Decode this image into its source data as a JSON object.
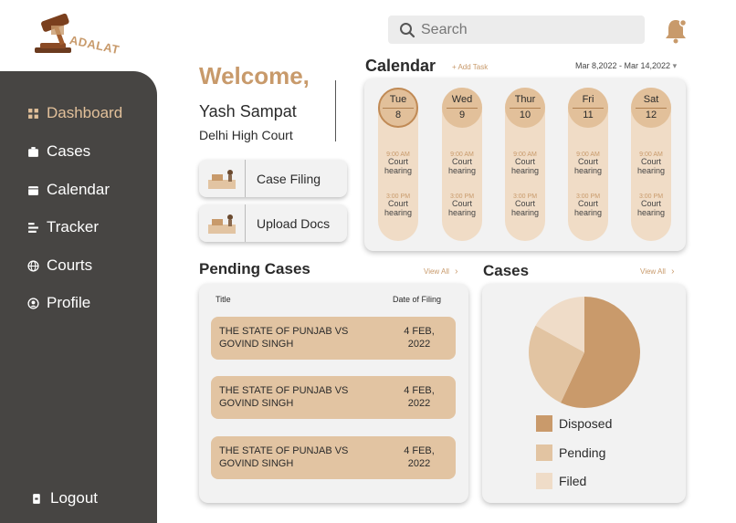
{
  "app": {
    "logo_text": "ADALAT"
  },
  "sidebar": {
    "items": [
      {
        "label": "Dashboard",
        "icon": "dashboard-icon"
      },
      {
        "label": "Cases",
        "icon": "briefcase-icon"
      },
      {
        "label": "Calendar",
        "icon": "calendar-icon"
      },
      {
        "label": "Tracker",
        "icon": "tracker-icon"
      },
      {
        "label": "Courts",
        "icon": "globe-icon"
      },
      {
        "label": "Profile",
        "icon": "user-icon"
      }
    ],
    "logout_label": "Logout"
  },
  "search": {
    "placeholder": "Search"
  },
  "welcome": {
    "greeting": "Welcome,",
    "name": "Yash Sampat",
    "court": "Delhi High Court"
  },
  "actions": {
    "case_filing": "Case Filing",
    "upload_docs": "Upload Docs"
  },
  "calendar": {
    "title": "Calendar",
    "add_task": "+ Add Task",
    "date_range": "Mar 8,2022 - Mar 14,2022",
    "days": [
      {
        "day": "Tue",
        "date": "8",
        "active": true,
        "events": [
          {
            "time": "9:00 AM",
            "line1": "Court",
            "line2": "hearing"
          },
          {
            "time": "3:00 PM",
            "line1": "Court",
            "line2": "hearing"
          }
        ]
      },
      {
        "day": "Wed",
        "date": "9",
        "active": false,
        "events": [
          {
            "time": "9:00 AM",
            "line1": "Court",
            "line2": "hearing"
          },
          {
            "time": "3:00 PM",
            "line1": "Court",
            "line2": "hearing"
          }
        ]
      },
      {
        "day": "Thur",
        "date": "10",
        "active": false,
        "events": [
          {
            "time": "9:00 AM",
            "line1": "Court",
            "line2": "hearing"
          },
          {
            "time": "3:00 PM",
            "line1": "Court",
            "line2": "hearing"
          }
        ]
      },
      {
        "day": "Fri",
        "date": "11",
        "active": false,
        "events": [
          {
            "time": "9:00 AM",
            "line1": "Court",
            "line2": "hearing"
          },
          {
            "time": "3:00 PM",
            "line1": "Court",
            "line2": "hearing"
          }
        ]
      },
      {
        "day": "Sat",
        "date": "12",
        "active": false,
        "events": [
          {
            "time": "9:00 AM",
            "line1": "Court",
            "line2": "hearing"
          },
          {
            "time": "3:00 PM",
            "line1": "Court",
            "line2": "hearing"
          }
        ]
      }
    ]
  },
  "pending_cases": {
    "title": "Pending Cases",
    "view_all": "View All",
    "columns": [
      "Title",
      "Date of Filing"
    ],
    "rows": [
      {
        "title_l1": "THE STATE OF PUNJAB VS",
        "title_l2": "GOVIND SINGH",
        "date_l1": "4 FEB,",
        "date_l2": "2022"
      },
      {
        "title_l1": "THE STATE OF PUNJAB VS",
        "title_l2": "GOVIND SINGH",
        "date_l1": "4 FEB,",
        "date_l2": "2022"
      },
      {
        "title_l1": "THE STATE OF PUNJAB VS",
        "title_l2": "GOVIND SINGH",
        "date_l1": "4 FEB,",
        "date_l2": "2022"
      }
    ]
  },
  "cases_chart": {
    "title": "Cases",
    "view_all": "View All"
  },
  "chart_data": {
    "type": "pie",
    "title": "",
    "categories": [
      "Disposed",
      "Pending",
      "Filed"
    ],
    "values": [
      57,
      26,
      17
    ],
    "colors": [
      "#c99a6b",
      "#e2c4a2",
      "#efdcc8"
    ],
    "legend": "bottom"
  },
  "colors": {
    "accent": "#c89a6b",
    "sidebar": "#474543",
    "light_tan": "#f0dcc6"
  }
}
